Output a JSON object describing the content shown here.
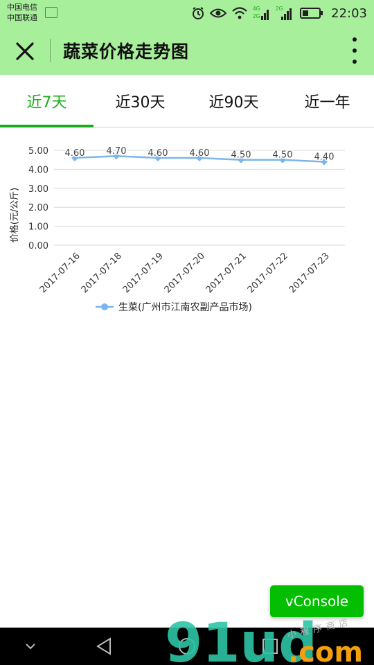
{
  "status_bar": {
    "carrier_1": "中国电信",
    "carrier_2": "中国联通",
    "net_label_1": "4G",
    "net_label_1b": "2G",
    "net_label_2": "2G",
    "time": "22:03"
  },
  "navbar": {
    "title": "蔬菜价格走势图"
  },
  "tabs": [
    {
      "label": "近7天",
      "active": true
    },
    {
      "label": "近30天",
      "active": false
    },
    {
      "label": "近90天",
      "active": false
    },
    {
      "label": "近一年",
      "active": false
    }
  ],
  "chart_data": {
    "type": "line",
    "title": "",
    "ylabel": "价格(元/公斤)",
    "xlabel": "",
    "ylim": [
      0,
      5
    ],
    "yticks": [
      "0.00",
      "1.00",
      "2.00",
      "3.00",
      "4.00",
      "5.00"
    ],
    "grid": true,
    "legend_placement": "bottom-center",
    "categories": [
      "2017-07-16",
      "2017-07-18",
      "2017-07-19",
      "2017-07-20",
      "2017-07-21",
      "2017-07-22",
      "2017-07-23"
    ],
    "series": [
      {
        "name": "生菜(广州市江南农副产品市场)",
        "color": "#7cb5ec",
        "values": [
          4.6,
          4.7,
          4.6,
          4.6,
          4.5,
          4.5,
          4.4
        ],
        "labels": [
          "4.60",
          "4.70",
          "4.60",
          "4.60",
          "4.50",
          "4.50",
          "4.40"
        ]
      }
    ]
  },
  "vconsole": {
    "label": "vConsole"
  },
  "watermark": {
    "brand": "91ud",
    "suffix": ".com",
    "tagline": "小程序商店"
  },
  "colors": {
    "navbar_bg": "#a8ef9c",
    "accent": "#1aad19",
    "vconsole_bg": "#04be02",
    "series": "#7cb5ec"
  }
}
